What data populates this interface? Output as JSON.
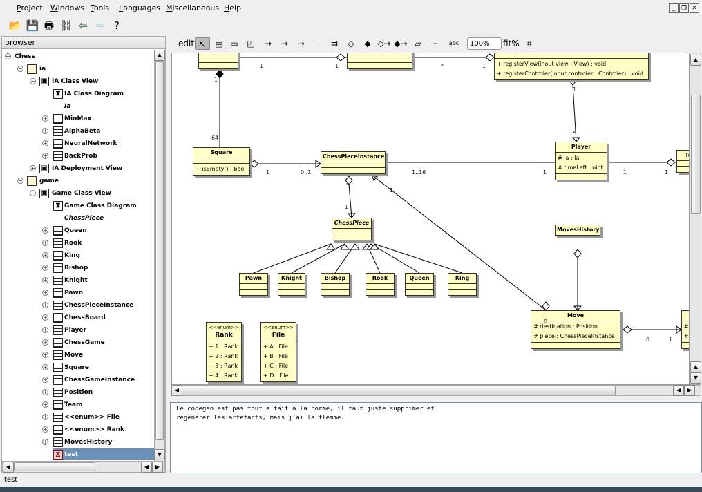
{
  "menu": [
    "Project",
    "Windows",
    "Tools",
    "Languages",
    "Miscellaneous",
    "Help"
  ],
  "toolbar": [
    {
      "icon": "open-folder-icon",
      "glyph": "📂"
    },
    {
      "icon": "save-icon",
      "glyph": "💾"
    },
    {
      "icon": "print-icon",
      "glyph": "🖶"
    },
    {
      "icon": "browse-diagrams-icon",
      "glyph": "⛓"
    },
    {
      "icon": "back-arrow-icon",
      "glyph": "⇦"
    },
    {
      "icon": "forward-arrow-icon",
      "glyph": "⇨"
    },
    {
      "icon": "whats-this-help-icon",
      "glyph": "?"
    }
  ],
  "browser": {
    "title": "browser",
    "items": [
      {
        "label": "Chess",
        "depth": 0,
        "kind": "none",
        "exp": "-"
      },
      {
        "label": "ia",
        "depth": 1,
        "kind": "folder",
        "exp": "-"
      },
      {
        "label": "IA Class View",
        "depth": 2,
        "kind": "view",
        "exp": "-"
      },
      {
        "label": "IA Class Diagram",
        "depth": 3,
        "kind": "diagram",
        "exp": ""
      },
      {
        "label": "Ia",
        "depth": 3,
        "kind": "none",
        "exp": "",
        "italic": true
      },
      {
        "label": "MinMax",
        "depth": 3,
        "kind": "class",
        "exp": "+"
      },
      {
        "label": "AlphaBeta",
        "depth": 3,
        "kind": "class",
        "exp": "+"
      },
      {
        "label": "NeuralNetwork",
        "depth": 3,
        "kind": "class",
        "exp": "+"
      },
      {
        "label": "BackProb",
        "depth": 3,
        "kind": "class",
        "exp": "+"
      },
      {
        "label": "IA Deployment View",
        "depth": 2,
        "kind": "view",
        "exp": "+"
      },
      {
        "label": "game",
        "depth": 1,
        "kind": "folder",
        "exp": "-"
      },
      {
        "label": "Game Class View",
        "depth": 2,
        "kind": "view",
        "exp": "-"
      },
      {
        "label": "Game Class Diagram",
        "depth": 3,
        "kind": "diagram",
        "exp": ""
      },
      {
        "label": "ChessPiece",
        "depth": 3,
        "kind": "none",
        "exp": "",
        "italic": true
      },
      {
        "label": "Queen",
        "depth": 3,
        "kind": "class",
        "exp": "+"
      },
      {
        "label": "Rook",
        "depth": 3,
        "kind": "class",
        "exp": "+"
      },
      {
        "label": "King",
        "depth": 3,
        "kind": "class",
        "exp": "+"
      },
      {
        "label": "Bishop",
        "depth": 3,
        "kind": "class",
        "exp": "+"
      },
      {
        "label": "Knight",
        "depth": 3,
        "kind": "class",
        "exp": "+"
      },
      {
        "label": "Pawn",
        "depth": 3,
        "kind": "class",
        "exp": "+"
      },
      {
        "label": "ChessPieceInstance",
        "depth": 3,
        "kind": "class",
        "exp": "+"
      },
      {
        "label": "ChessBoard",
        "depth": 3,
        "kind": "class",
        "exp": "+"
      },
      {
        "label": "Player",
        "depth": 3,
        "kind": "class",
        "exp": "+"
      },
      {
        "label": "ChessGame",
        "depth": 3,
        "kind": "class",
        "exp": "+"
      },
      {
        "label": "Move",
        "depth": 3,
        "kind": "class",
        "exp": "+"
      },
      {
        "label": "Square",
        "depth": 3,
        "kind": "class",
        "exp": "+"
      },
      {
        "label": "ChessGameInstance",
        "depth": 3,
        "kind": "class",
        "exp": "+"
      },
      {
        "label": "Position",
        "depth": 3,
        "kind": "class",
        "exp": "+"
      },
      {
        "label": "Team",
        "depth": 3,
        "kind": "class",
        "exp": "+"
      },
      {
        "label": "<<enum>> File",
        "depth": 3,
        "kind": "class",
        "exp": "+"
      },
      {
        "label": "<<enum>> Rank",
        "depth": 3,
        "kind": "class",
        "exp": "+"
      },
      {
        "label": "MovesHistory",
        "depth": 3,
        "kind": "class",
        "exp": "+"
      },
      {
        "label": "test",
        "depth": 3,
        "kind": "test",
        "exp": "",
        "selected": true
      }
    ]
  },
  "diagram_toolbar": {
    "mode": "edit",
    "zoom": "100%",
    "fit": "fit%"
  },
  "diagram": {
    "classes": [
      {
        "name": "",
        "attrs": [],
        "ops": []
      },
      {
        "name": "",
        "attrs": [],
        "ops": []
      },
      {
        "name": "",
        "attrs": null,
        "ops": [
          "+  registerView(inout view : View) : void",
          "+  registerControler(inout controler : Controler) : void"
        ]
      },
      {
        "name": "Square",
        "attrs": [],
        "ops": [
          "+  isEmpty() : bool"
        ]
      },
      {
        "name": "ChessPieceInstance",
        "attrs": [],
        "ops": []
      },
      {
        "name": "Player",
        "attrs": [
          "#  ia : Ia",
          "#  timeLeft : uint"
        ],
        "ops": []
      },
      {
        "name": "Tea",
        "attrs": [],
        "ops": []
      },
      {
        "name": "ChessPiece",
        "italic": true,
        "attrs": [],
        "ops": []
      },
      {
        "name": "Pawn",
        "attrs": [],
        "ops": []
      },
      {
        "name": "Knight",
        "attrs": [],
        "ops": []
      },
      {
        "name": "Bishop",
        "attrs": [],
        "ops": []
      },
      {
        "name": "Rook",
        "attrs": [],
        "ops": []
      },
      {
        "name": "Queen",
        "attrs": [],
        "ops": []
      },
      {
        "name": "King",
        "attrs": [],
        "ops": []
      },
      {
        "name": "MovesHistory",
        "attrs": null,
        "ops": null
      },
      {
        "name": "Move",
        "attrs": [
          "#  destination : Position",
          "#  piece : ChessPieceInstance"
        ],
        "ops": []
      },
      {
        "name": "",
        "attrs": [
          "#",
          "#"
        ],
        "ops": []
      },
      {
        "name": "Rank",
        "stereotype": "<<enum>>",
        "attrs": [
          "+  1 : Rank",
          "+  2 : Rank",
          "+  3 : Rank",
          "+  4 : Rank"
        ],
        "ops": null
      },
      {
        "name": "File",
        "stereotype": "<<enum>>",
        "attrs": [
          "+  A : File",
          "+  B : File",
          "+  C : File",
          "+  D : File"
        ],
        "ops": null
      }
    ],
    "multiplicities": [
      "1",
      "1",
      "*",
      "1",
      "1",
      "64",
      "1",
      "2",
      "1",
      "0..1",
      "1..16",
      "1",
      "1",
      "1",
      "*",
      "1",
      "1",
      "0",
      "0",
      "1"
    ]
  },
  "comment": "Le codegen est pas tout à fait à la norme, il faut juste supprimer et\nregénérer les artefacts, mais j'ai la flemme.",
  "status": "test",
  "colors": {
    "class_fill": "#ffffc6",
    "selection": "#6a8fb8"
  }
}
